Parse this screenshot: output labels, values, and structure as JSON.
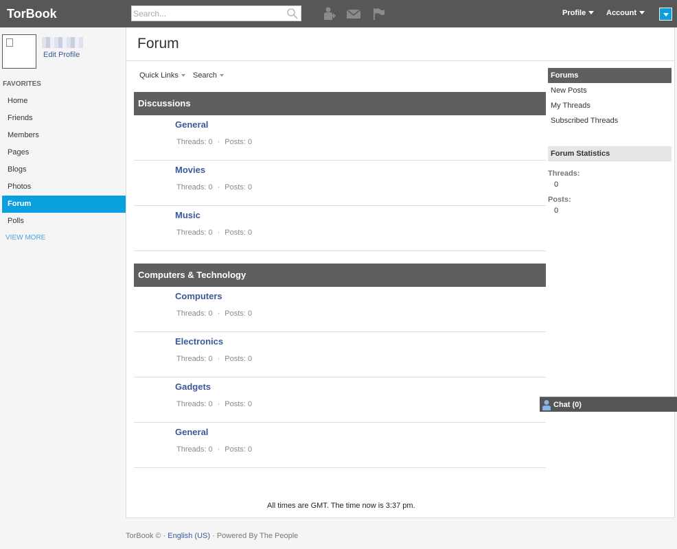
{
  "header": {
    "brand": "TorBook",
    "search_placeholder": "Search...",
    "profile_label": "Profile",
    "account_label": "Account"
  },
  "sidebar": {
    "edit_profile": "Edit Profile",
    "favorites_title": "FAVORITES",
    "items": [
      {
        "label": "Home"
      },
      {
        "label": "Friends"
      },
      {
        "label": "Members"
      },
      {
        "label": "Pages"
      },
      {
        "label": "Blogs"
      },
      {
        "label": "Photos"
      },
      {
        "label": "Forum"
      },
      {
        "label": "Polls"
      }
    ],
    "active_item": "Forum",
    "view_more": "VIEW MORE"
  },
  "main": {
    "title": "Forum",
    "quick_links": "Quick Links",
    "search": "Search",
    "categories": [
      {
        "name": "Discussions",
        "forums": [
          {
            "name": "General",
            "threads": "Threads: 0",
            "posts": "Posts: 0"
          },
          {
            "name": "Movies",
            "threads": "Threads: 0",
            "posts": "Posts: 0"
          },
          {
            "name": "Music",
            "threads": "Threads: 0",
            "posts": "Posts: 0"
          }
        ]
      },
      {
        "name": "Computers & Technology",
        "forums": [
          {
            "name": "Computers",
            "threads": "Threads: 0",
            "posts": "Posts: 0"
          },
          {
            "name": "Electronics",
            "threads": "Threads: 0",
            "posts": "Posts: 0"
          },
          {
            "name": "Gadgets",
            "threads": "Threads: 0",
            "posts": "Posts: 0"
          },
          {
            "name": "General",
            "threads": "Threads: 0",
            "posts": "Posts: 0"
          }
        ]
      }
    ],
    "stat_separator": "·",
    "time_note": "All times are GMT. The time now is 3:37 pm."
  },
  "right": {
    "forums_title": "Forums",
    "links": [
      "New Posts",
      "My Threads",
      "Subscribed Threads"
    ],
    "stats_title": "Forum Statistics",
    "threads_label": "Threads:",
    "threads_value": "0",
    "posts_label": "Posts:",
    "posts_value": "0"
  },
  "chat": {
    "label": "Chat (0)"
  },
  "footer": {
    "prefix": "TorBook © ·",
    "language": "English (US)",
    "suffix": "· Powered By The People"
  },
  "colors": {
    "topbar": "#575757",
    "accent": "#0aa0e0",
    "link": "#3b5998",
    "category_header": "#5f5f5f"
  }
}
